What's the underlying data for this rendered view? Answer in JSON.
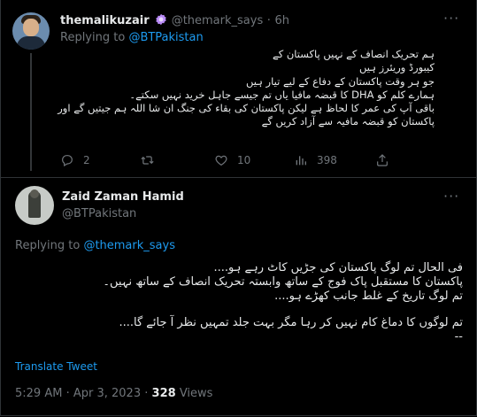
{
  "reply_tweet": {
    "display_name": "themalikuzair",
    "handle": "@themark_says",
    "separator": "·",
    "time": "6h",
    "replying_prefix": "Replying to",
    "replying_to": "@BTPakistan",
    "lines": [
      "ہم تحریک انصاف کے نہیں پاکستان کے",
      "کیبورڈ وریئرز ہیں",
      "جو ہر وقت پاکستان کے دفاع کے لیے تیار ہیں",
      "ہمارے کلم کو DHA کا قبضہ مافیا یاں تم جیسے جاہل خرید نہیں سکتے۔",
      "باقی آپ کی عمر کا لحاظ ہے لیکن پاکستان کی  بقاء کی جنگ ان شا اللہ ہم جیتیں گے اور",
      "پاکستان کو قبضہ مافیہ سے آزاد کریں گے"
    ],
    "stats": {
      "replies": "2",
      "likes": "10",
      "views": "398"
    }
  },
  "main_tweet": {
    "display_name": "Zaid Zaman Hamid",
    "handle": "@BTPakistan",
    "replying_prefix": "Replying to",
    "replying_to": "@themark_says",
    "lines": [
      "فی الحال تم لوگ پاکستان کی جڑیں کاٹ رہے ہو....",
      "پاکستان کا مستقبل پاک فوج کے ساتھ وابستہ تحریک انصاف کے ساتھ نہیں۔",
      "تم لوگ تاریخ کے غلط جانب کھڑے ہو....",
      "تم لوگوں کا دماغ کام نہیں کر رہا مگر بہت جلد تمہیں نظر آ جائے گا....",
      "--"
    ],
    "translate_label": "Translate Tweet",
    "time": "5:29 AM",
    "date_separator": "·",
    "date": "Apr 3, 2023",
    "views_count": "328",
    "views_label": "Views"
  },
  "colors": {
    "accent": "#1d9bf0",
    "muted": "#71767b",
    "text": "#e7e9ea",
    "background": "#000000",
    "badge": "#b88af5"
  },
  "icons": [
    "more-icon",
    "verified-badge-icon",
    "reply-icon",
    "retweet-icon",
    "like-icon",
    "views-icon",
    "share-icon"
  ]
}
